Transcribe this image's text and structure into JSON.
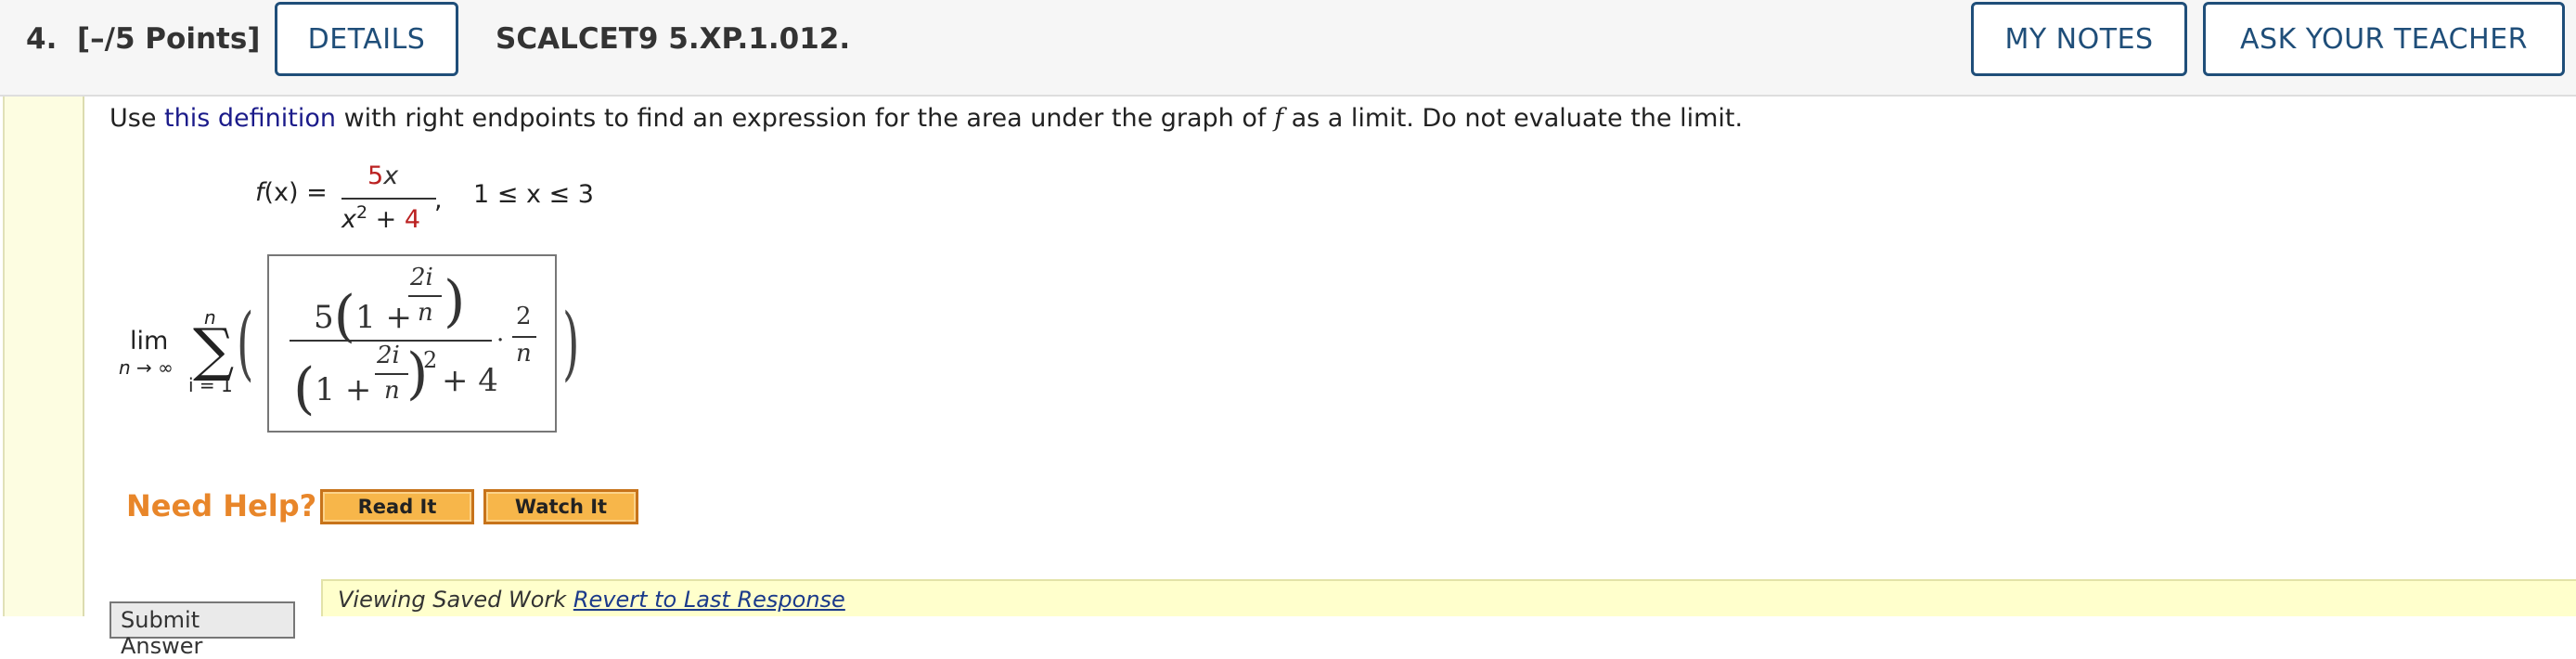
{
  "header": {
    "question_number": "4.",
    "points": "[–/5 Points]",
    "details_label": "DETAILS",
    "question_code": "SCALCET9 5.XP.1.012.",
    "my_notes_label": "MY NOTES",
    "ask_teacher_label": "ASK YOUR TEACHER"
  },
  "prompt": {
    "before_link": "Use ",
    "link_text": "this definition",
    "after_link": " with right endpoints to find an expression for the area under the graph of ",
    "f_var": "f",
    "tail": " as a limit. Do not evaluate the limit."
  },
  "function": {
    "lhs_f": "f",
    "lhs_rest": "(x) =",
    "numerator_coef": "5",
    "numerator_var": "x",
    "denominator_x": "x",
    "denominator_exp": "2",
    "denominator_plus": " + ",
    "denominator_const": "4",
    "comma": ",",
    "domain": "1 ≤ x ≤ 3"
  },
  "limit_expression": {
    "lim": "lim",
    "lim_sub": "n → ∞",
    "sum_upper": "n",
    "sigma": "∑",
    "sum_lower": "i = 1",
    "open_paren": "(",
    "close_paren": ")",
    "answer": {
      "num_coef": "5",
      "num_open": "(",
      "num_one_plus": "1 +",
      "two_i": "2i",
      "n": "n",
      "num_close": ")",
      "den_open": "(",
      "den_one_plus": "1 +",
      "den_close": ")",
      "den_exp": "2",
      "den_plus_four": "+ 4",
      "dot": "·",
      "two": "2",
      "n2": "n"
    }
  },
  "help": {
    "label": "Need Help?",
    "read_it": "Read It",
    "watch_it": "Watch It"
  },
  "footer": {
    "submit_label": "Submit Answer",
    "viewing_text": "Viewing Saved Work ",
    "revert_link": "Revert to Last Response"
  }
}
